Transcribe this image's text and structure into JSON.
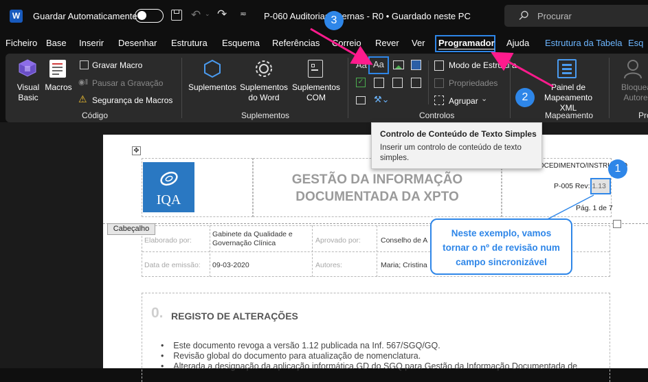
{
  "titlebar": {
    "app_icon": "word-icon",
    "autosave_label": "Guardar Automaticamente",
    "doc_title": "P-060 Auditorias Internas - R0 • Guardado neste PC",
    "search_placeholder": "Procurar"
  },
  "menu": {
    "items": [
      "Ficheiro",
      "Base",
      "Inserir",
      "Desenhar",
      "Estrutura",
      "Esquema",
      "Referências",
      "Correio",
      "Rever",
      "Ver",
      "Programador",
      "Ajuda",
      "Estrutura da Tabela",
      "Esq"
    ]
  },
  "ribbon": {
    "codigo": {
      "visual_basic": "Visual Basic",
      "macros": "Macros",
      "gravar_macro": "Gravar Macro",
      "pausar": "Pausar a Gravação",
      "seguranca": "Segurança de Macros",
      "label": "Código"
    },
    "suplementos": {
      "suplementos": "Suplementos",
      "word": "Suplementos do Word",
      "com": "Suplementos COM",
      "label": "Suplementos"
    },
    "controlos": {
      "modo": "Modo de Estrutura",
      "propriedades": "Propriedades",
      "agrupar": "Agrupar",
      "label": "Controlos"
    },
    "mapeamento": {
      "painel": "Painel de Mapeamento XML",
      "label": "Mapeamento"
    },
    "proteger": {
      "bloquear": "Bloquear Autores",
      "label": "Pro"
    }
  },
  "tooltip": {
    "title": "Controlo de Conteúdo de Texto Simples",
    "body": "Inserir um controlo de conteúdo de texto simples."
  },
  "callouts": {
    "one": "1",
    "two": "2",
    "three": "3",
    "bubble": "Neste exemplo, vamos tornar o nº de revisão num campo sincronizável"
  },
  "document": {
    "header_tag": "Cabeçalho",
    "logo_text": "IQA",
    "title_line1": "GESTÃO DA INFORMAÇÃO",
    "title_line2": "DOCUMENTADA DA XPTO",
    "doc_type": "PROCEDIMENTO/INSTRUÇÃO",
    "code": "P-005 Rev: 1.13",
    "page": "Pág. 1 de 7",
    "elaborado_label": "Elaborado por:",
    "elaborado_val": "Gabinete da Qualidade e Governação Clínica",
    "aprovado_label": "Aprovado por:",
    "aprovado_val": "Conselho de A",
    "data_label": "Data de emissão:",
    "data_val": "09-03-2020",
    "autores_label": "Autores:",
    "autores_val": "Maria; Cristina",
    "section_num": "0.",
    "section_title": "REGISTO DE ALTERAÇÕES",
    "bullets": [
      "Este documento revoga a versão 1.12 publicada na Inf. 567/SGQ/GQ.",
      "Revisão global do documento para atualização de nomenclatura.",
      "Alterada a designação da aplicação informática GD do SGQ para Gestão da Informação Documentada de"
    ]
  },
  "colors": {
    "accent": "#2e86e8",
    "arrow": "#ff1b8d",
    "link": "#6cb6ff",
    "logo_bg": "#2a78c2"
  }
}
